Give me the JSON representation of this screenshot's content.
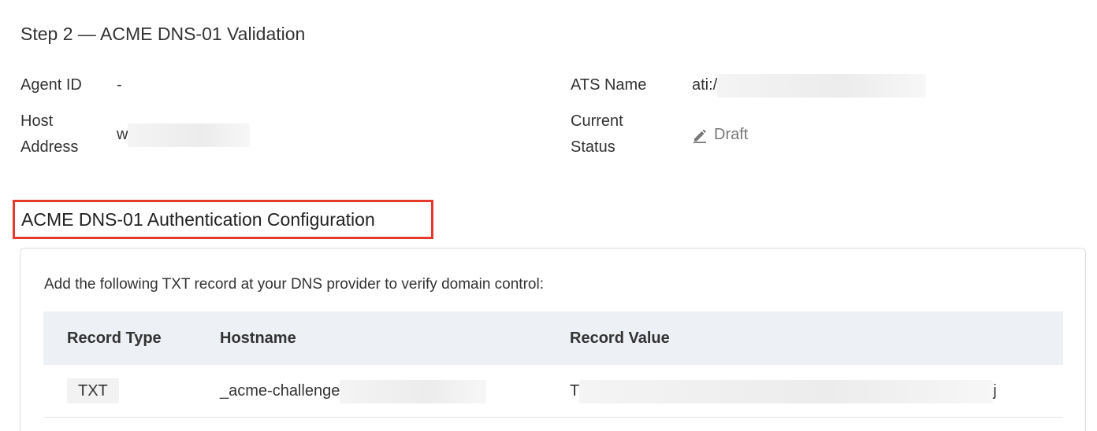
{
  "header": {
    "step_title": "Step 2 — ACME DNS-01 Validation"
  },
  "info": {
    "agent_id_label": "Agent ID",
    "agent_id_value": "-",
    "ats_name_label": "ATS Name",
    "ats_name_value": "ati:/",
    "host_address_label_line1": "Host",
    "host_address_label_line2": "Address",
    "host_address_value": "w",
    "current_status_label_line1": "Current",
    "current_status_label_line2": "Status",
    "current_status_value": "Draft",
    "status_icon": "pencil-icon",
    "status_color": "#777777"
  },
  "config": {
    "title": "ACME DNS-01 Authentication Configuration",
    "highlight_color": "#e4392b",
    "instruction": "Add the following TXT record at your DNS provider to verify domain control:",
    "table": {
      "columns": [
        "Record Type",
        "Hostname",
        "Record Value"
      ],
      "rows": [
        {
          "record_type": "TXT",
          "hostname": "_acme-challenge",
          "value_start": "T",
          "value_end": "j"
        }
      ]
    }
  }
}
